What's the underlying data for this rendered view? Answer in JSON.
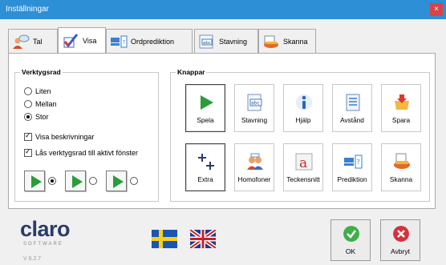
{
  "window": {
    "title": "Inställningar",
    "close_glyph": "×"
  },
  "tabs": [
    {
      "label": "Tal",
      "icon": "person-speech-icon",
      "active": false
    },
    {
      "label": "Visa",
      "icon": "checkmark-icon",
      "active": true
    },
    {
      "label": "Ordprediktion",
      "icon": "word-prediction-icon",
      "active": false
    },
    {
      "label": "Stavning",
      "icon": "spelling-icon",
      "active": false
    },
    {
      "label": "Skanna",
      "icon": "scanner-icon",
      "active": false
    }
  ],
  "toolbar_group": {
    "title": "Verktygsrad",
    "size_options": [
      {
        "label": "Liten",
        "selected": false
      },
      {
        "label": "Mellan",
        "selected": false
      },
      {
        "label": "Stor",
        "selected": true
      }
    ],
    "checkboxes": [
      {
        "label": "Visa beskrivningar",
        "checked": true
      },
      {
        "label": "Lås verktygsrad till aktivt fönster",
        "checked": true
      }
    ],
    "style_options": [
      {
        "selected": true
      },
      {
        "selected": false
      },
      {
        "selected": false
      }
    ]
  },
  "buttons_group": {
    "title": "Knappar",
    "buttons": [
      {
        "label": "Spela",
        "icon": "play-icon",
        "selected": true
      },
      {
        "label": "Stavning",
        "icon": "spelling-icon",
        "selected": false
      },
      {
        "label": "Hjälp",
        "icon": "info-icon",
        "selected": false
      },
      {
        "label": "Avstånd",
        "icon": "document-icon",
        "selected": false
      },
      {
        "label": "Spara",
        "icon": "save-folder-icon",
        "selected": false
      },
      {
        "label": "Extra",
        "icon": "plus-plus-icon",
        "selected": true
      },
      {
        "label": "Homofoner",
        "icon": "homophones-icon",
        "selected": false
      },
      {
        "label": "Teckensnitt",
        "icon": "font-icon",
        "selected": false
      },
      {
        "label": "Prediktion",
        "icon": "word-prediction-icon",
        "selected": false
      },
      {
        "label": "Skanna",
        "icon": "scanner-icon",
        "selected": false
      }
    ]
  },
  "footer": {
    "logo_text": "claro",
    "logo_subtext": "SOFTWARE",
    "version": "V 6.2.7",
    "flags": [
      "swedish-flag-icon",
      "uk-flag-icon"
    ],
    "ok_label": "OK",
    "cancel_label": "Avbryt"
  },
  "colors": {
    "titlebar": "#2d8fd5",
    "close": "#d9434a",
    "ok": "#3fae49",
    "cancel": "#d4323b",
    "play": "#2a9d3a"
  }
}
